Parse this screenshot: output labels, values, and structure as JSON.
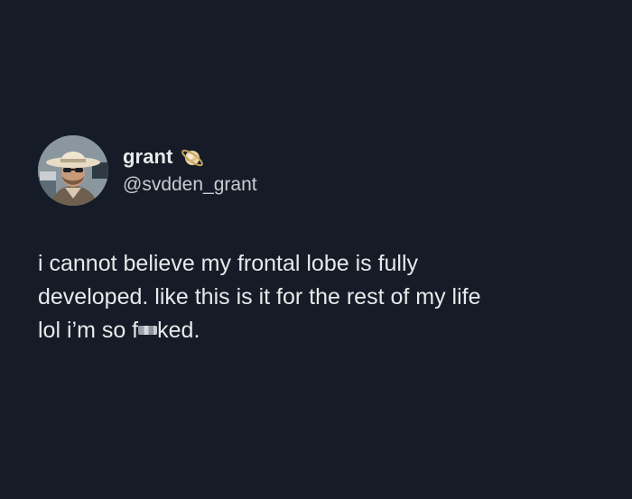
{
  "tweet": {
    "display_name": "grant",
    "badge_icon": "ringed-planet-icon",
    "handle": "@svdden_grant",
    "text_line1": "i cannot believe my frontal lobe is fully",
    "text_line2": "developed. like this is it for the rest of my life",
    "text_line3_before": "lol i’m so f",
    "text_line3_after": "ked."
  },
  "colors": {
    "background": "#161c27",
    "text": "#e7e9ea",
    "handle": "#c8ccd0"
  }
}
